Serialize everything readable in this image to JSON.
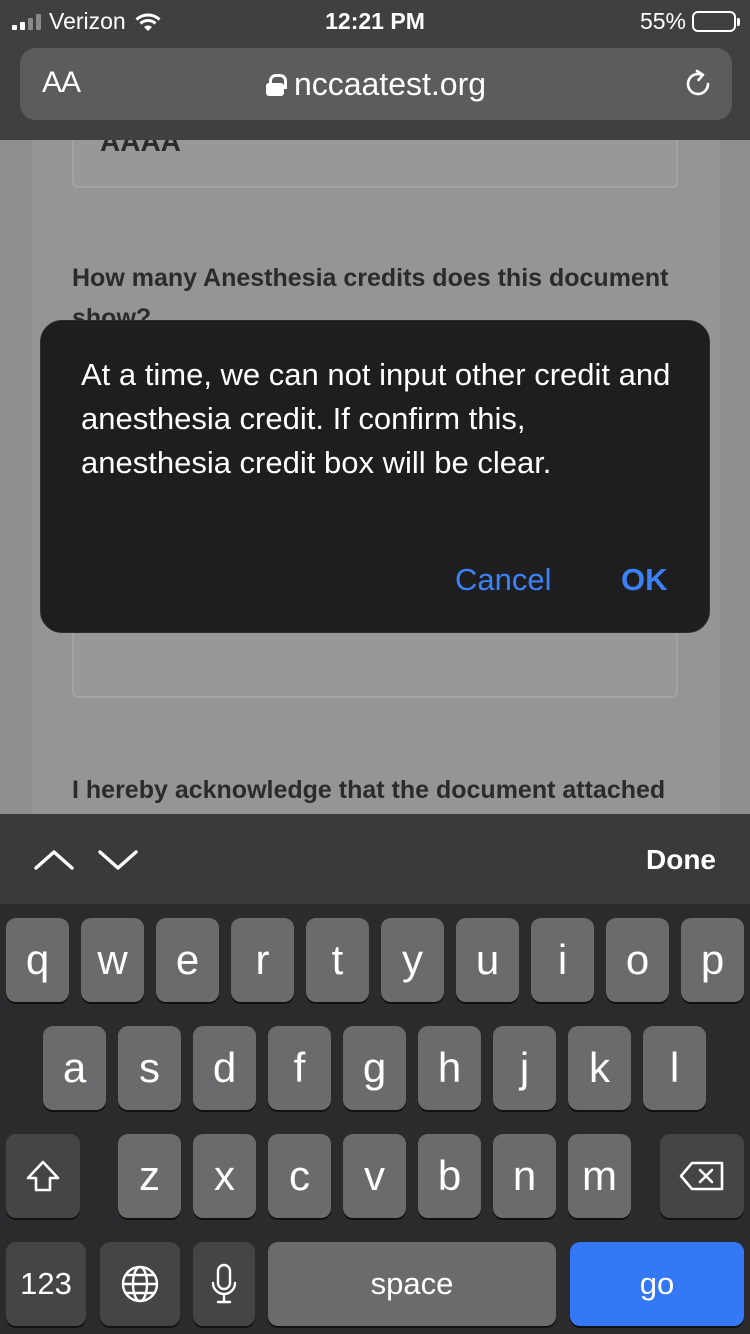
{
  "status_bar": {
    "carrier": "Verizon",
    "time": "12:21 PM",
    "battery_percent": "55%",
    "battery_level": 0.55
  },
  "url_bar": {
    "text_size_label": "AA",
    "address": "nccaatest.org",
    "lock_icon": "lock-icon",
    "reload_icon": "reload-icon"
  },
  "page": {
    "field_value": "AAAA",
    "question_1": "How many Anesthesia credits does this document",
    "question_1_cont": "show?",
    "acknowledgement": "I hereby acknowledge that the document attached"
  },
  "alert": {
    "message": "At a time, we can not input other credit and anesthesia credit. If confirm this, anesthesia credit box will be clear.",
    "cancel_label": "Cancel",
    "ok_label": "OK",
    "accent": "#3b82f6"
  },
  "accessory_bar": {
    "prev_icon": "chevron-up-icon",
    "next_icon": "chevron-down-icon",
    "done_label": "Done"
  },
  "keyboard": {
    "row1": [
      "q",
      "w",
      "e",
      "r",
      "t",
      "y",
      "u",
      "i",
      "o",
      "p"
    ],
    "row2": [
      "a",
      "s",
      "d",
      "f",
      "g",
      "h",
      "j",
      "k",
      "l"
    ],
    "row3": [
      "z",
      "x",
      "c",
      "v",
      "b",
      "n",
      "m"
    ],
    "numbers_label": "123",
    "space_label": "space",
    "go_label": "go",
    "go_color": "#3478f6"
  }
}
